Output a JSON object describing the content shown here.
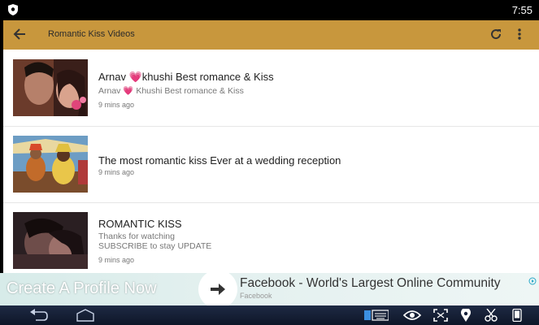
{
  "status_bar": {
    "time": "7:55"
  },
  "app_bar": {
    "title": "Romantic Kiss Videos"
  },
  "videos": [
    {
      "title": "Arnav 💗khushi Best romance & Kiss",
      "description": "Arnav 💗 Khushi Best romance & Kiss",
      "time_ago": "9 mins ago"
    },
    {
      "title": "The most romantic kiss Ever at a wedding reception",
      "time_ago": "9 mins ago"
    },
    {
      "title": "ROMANTIC KISS",
      "description_lines": [
        "Thanks for watching",
        "SUBSCRIBE to stay UPDATE"
      ],
      "time_ago": "9 mins ago"
    }
  ],
  "ad": {
    "headline": "Create A Profile Now",
    "title": "Facebook - World's Largest Online Community",
    "subtitle": "Facebook"
  },
  "colors": {
    "app_bar": "#c8973d",
    "nav_bar": "#15203a",
    "ad_bg": "#e3f0ef"
  }
}
